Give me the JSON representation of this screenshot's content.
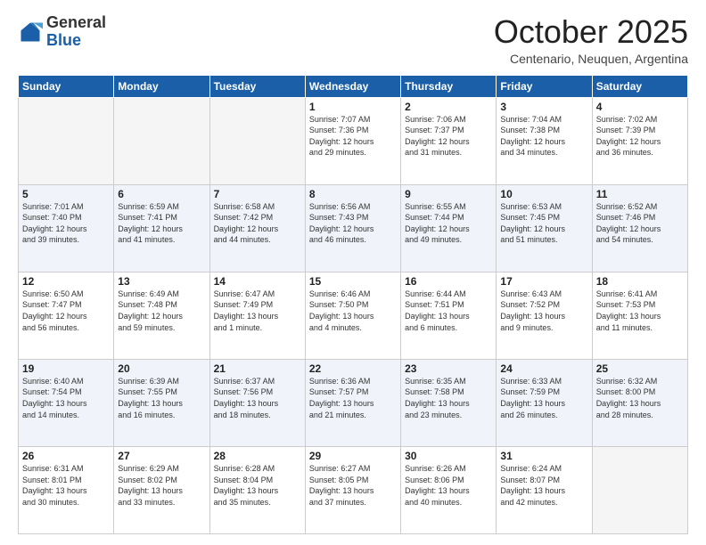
{
  "logo": {
    "general": "General",
    "blue": "Blue"
  },
  "header": {
    "month": "October 2025",
    "location": "Centenario, Neuquen, Argentina"
  },
  "days_of_week": [
    "Sunday",
    "Monday",
    "Tuesday",
    "Wednesday",
    "Thursday",
    "Friday",
    "Saturday"
  ],
  "weeks": [
    [
      {
        "day": "",
        "info": ""
      },
      {
        "day": "",
        "info": ""
      },
      {
        "day": "",
        "info": ""
      },
      {
        "day": "1",
        "info": "Sunrise: 7:07 AM\nSunset: 7:36 PM\nDaylight: 12 hours\nand 29 minutes."
      },
      {
        "day": "2",
        "info": "Sunrise: 7:06 AM\nSunset: 7:37 PM\nDaylight: 12 hours\nand 31 minutes."
      },
      {
        "day": "3",
        "info": "Sunrise: 7:04 AM\nSunset: 7:38 PM\nDaylight: 12 hours\nand 34 minutes."
      },
      {
        "day": "4",
        "info": "Sunrise: 7:02 AM\nSunset: 7:39 PM\nDaylight: 12 hours\nand 36 minutes."
      }
    ],
    [
      {
        "day": "5",
        "info": "Sunrise: 7:01 AM\nSunset: 7:40 PM\nDaylight: 12 hours\nand 39 minutes."
      },
      {
        "day": "6",
        "info": "Sunrise: 6:59 AM\nSunset: 7:41 PM\nDaylight: 12 hours\nand 41 minutes."
      },
      {
        "day": "7",
        "info": "Sunrise: 6:58 AM\nSunset: 7:42 PM\nDaylight: 12 hours\nand 44 minutes."
      },
      {
        "day": "8",
        "info": "Sunrise: 6:56 AM\nSunset: 7:43 PM\nDaylight: 12 hours\nand 46 minutes."
      },
      {
        "day": "9",
        "info": "Sunrise: 6:55 AM\nSunset: 7:44 PM\nDaylight: 12 hours\nand 49 minutes."
      },
      {
        "day": "10",
        "info": "Sunrise: 6:53 AM\nSunset: 7:45 PM\nDaylight: 12 hours\nand 51 minutes."
      },
      {
        "day": "11",
        "info": "Sunrise: 6:52 AM\nSunset: 7:46 PM\nDaylight: 12 hours\nand 54 minutes."
      }
    ],
    [
      {
        "day": "12",
        "info": "Sunrise: 6:50 AM\nSunset: 7:47 PM\nDaylight: 12 hours\nand 56 minutes."
      },
      {
        "day": "13",
        "info": "Sunrise: 6:49 AM\nSunset: 7:48 PM\nDaylight: 12 hours\nand 59 minutes."
      },
      {
        "day": "14",
        "info": "Sunrise: 6:47 AM\nSunset: 7:49 PM\nDaylight: 13 hours\nand 1 minute."
      },
      {
        "day": "15",
        "info": "Sunrise: 6:46 AM\nSunset: 7:50 PM\nDaylight: 13 hours\nand 4 minutes."
      },
      {
        "day": "16",
        "info": "Sunrise: 6:44 AM\nSunset: 7:51 PM\nDaylight: 13 hours\nand 6 minutes."
      },
      {
        "day": "17",
        "info": "Sunrise: 6:43 AM\nSunset: 7:52 PM\nDaylight: 13 hours\nand 9 minutes."
      },
      {
        "day": "18",
        "info": "Sunrise: 6:41 AM\nSunset: 7:53 PM\nDaylight: 13 hours\nand 11 minutes."
      }
    ],
    [
      {
        "day": "19",
        "info": "Sunrise: 6:40 AM\nSunset: 7:54 PM\nDaylight: 13 hours\nand 14 minutes."
      },
      {
        "day": "20",
        "info": "Sunrise: 6:39 AM\nSunset: 7:55 PM\nDaylight: 13 hours\nand 16 minutes."
      },
      {
        "day": "21",
        "info": "Sunrise: 6:37 AM\nSunset: 7:56 PM\nDaylight: 13 hours\nand 18 minutes."
      },
      {
        "day": "22",
        "info": "Sunrise: 6:36 AM\nSunset: 7:57 PM\nDaylight: 13 hours\nand 21 minutes."
      },
      {
        "day": "23",
        "info": "Sunrise: 6:35 AM\nSunset: 7:58 PM\nDaylight: 13 hours\nand 23 minutes."
      },
      {
        "day": "24",
        "info": "Sunrise: 6:33 AM\nSunset: 7:59 PM\nDaylight: 13 hours\nand 26 minutes."
      },
      {
        "day": "25",
        "info": "Sunrise: 6:32 AM\nSunset: 8:00 PM\nDaylight: 13 hours\nand 28 minutes."
      }
    ],
    [
      {
        "day": "26",
        "info": "Sunrise: 6:31 AM\nSunset: 8:01 PM\nDaylight: 13 hours\nand 30 minutes."
      },
      {
        "day": "27",
        "info": "Sunrise: 6:29 AM\nSunset: 8:02 PM\nDaylight: 13 hours\nand 33 minutes."
      },
      {
        "day": "28",
        "info": "Sunrise: 6:28 AM\nSunset: 8:04 PM\nDaylight: 13 hours\nand 35 minutes."
      },
      {
        "day": "29",
        "info": "Sunrise: 6:27 AM\nSunset: 8:05 PM\nDaylight: 13 hours\nand 37 minutes."
      },
      {
        "day": "30",
        "info": "Sunrise: 6:26 AM\nSunset: 8:06 PM\nDaylight: 13 hours\nand 40 minutes."
      },
      {
        "day": "31",
        "info": "Sunrise: 6:24 AM\nSunset: 8:07 PM\nDaylight: 13 hours\nand 42 minutes."
      },
      {
        "day": "",
        "info": ""
      }
    ]
  ]
}
